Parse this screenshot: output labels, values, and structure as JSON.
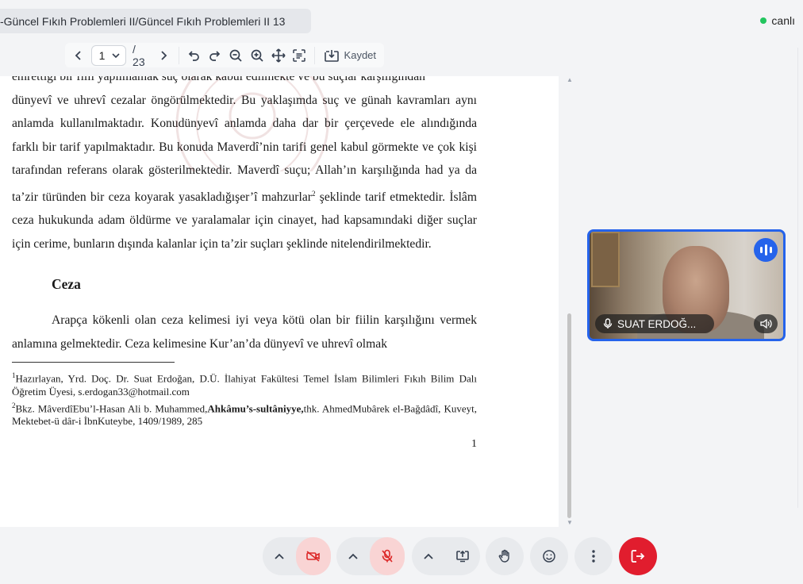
{
  "header": {
    "title": "-Güncel Fıkıh Problemleri II/Güncel Fıkıh Problemleri II 13",
    "status_label": "canlı",
    "status_color": "#22c55e"
  },
  "viewer": {
    "current_page": "1",
    "total_pages": "/ 23",
    "save_label": "Kaydet"
  },
  "document": {
    "lines_top": [
      "emrettiği bir fiili yapılmamak suç olarak kabul edilmekte ve bu suçlar karşılığından"
    ],
    "para1": "dünyevî ve uhrevî cezalar öngörülmektedir. Bu yaklaşımda suç ve günah kavramları aynı anlamda kullanılmaktadır. Konudünyevî anlamda daha dar bir çerçevede ele alındığında farklı bir tarif yapılmaktadır. Bu konuda Maverdî’nin tarifi genel kabul görmekte ve çok kişi tarafından referans olarak gösterilmektedir. Maverdî suçu; Allah’ın karşılığında had ya da ta’zir türünden bir ceza koyarak yasakladığışer’î mahzurlar",
    "para1_sup": "2",
    "para1_tail": " şeklinde tarif etmektedir. İslâm ceza hukukunda adam öldürme ve yaralamalar için cinayet, had kapsamındaki diğer suçlar için cerime, bunların dışında kalanlar için ta’zir suçları şeklinde nitelendirilmektedir.",
    "heading": "Ceza",
    "para2": "Arapça kökenli olan ceza kelimesi iyi veya kötü olan bir fiilin karşılığını vermek anlamına gelmektedir. Ceza kelimesine Kur’an’da dünyevî ve uhrevî olmak",
    "footnote1_num": "1",
    "footnote1": "Hazırlayan, Yrd. Doç. Dr. Suat Erdoğan, D.Ü. İlahiyat Fakültesi Temel İslam Bilimleri Fıkıh Bilim Dalı Öğretim Üyesi, s.erdogan33@hotmail.com",
    "footnote2_num": "2",
    "footnote2_a": "Bkz. MâverdîEbu’l-Hasan Ali b. Muhammed,",
    "footnote2_bold": "Ahkâmu’s-sultâniyye,",
    "footnote2_b": "thk. AhmedMubârek el-Bağdâdî, Kuveyt, Mektebet-ü dâr-i İbnKuteybe, 1409/1989, 285",
    "page_number": "1"
  },
  "participant": {
    "name": "SUAT ERDOĞ...",
    "speaking": true,
    "highlight_color": "#2563eb"
  },
  "controls": {
    "leave_color": "#e11d2e",
    "muted_bg": "#f9d4d4"
  }
}
